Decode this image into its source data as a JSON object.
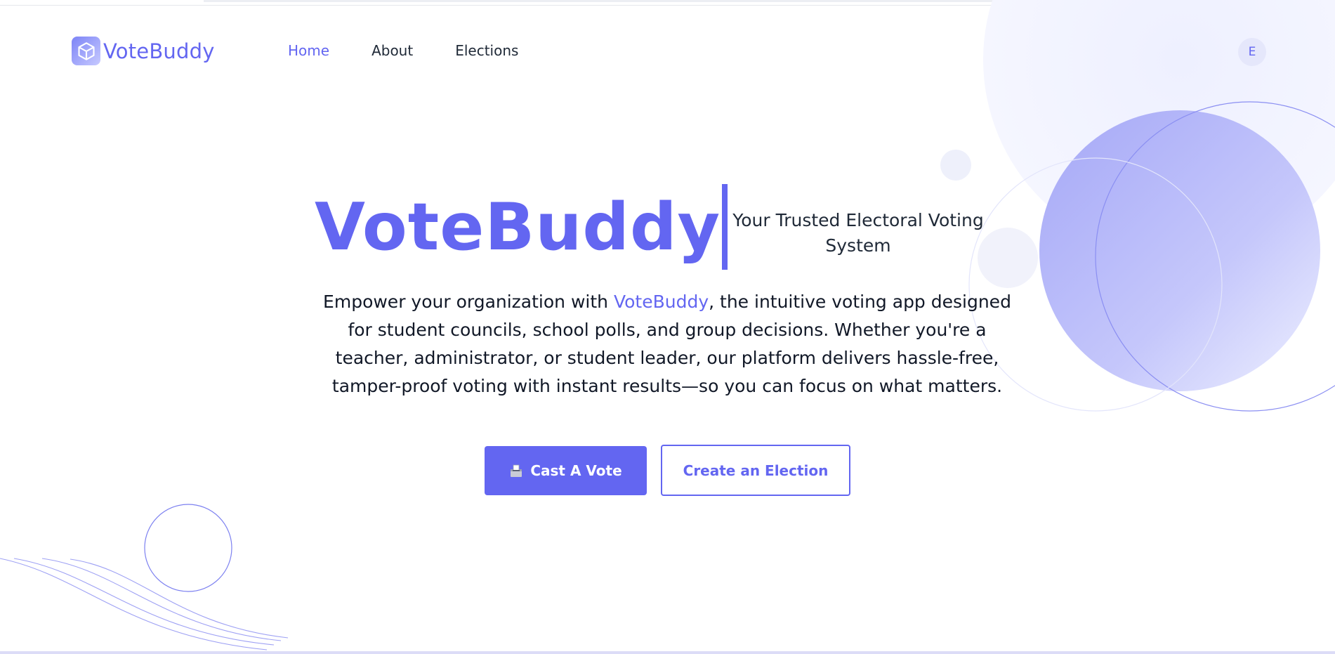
{
  "brand": {
    "name": "VoteBuddy",
    "logo_icon": "cube-icon"
  },
  "nav": {
    "items": [
      {
        "label": "Home",
        "active": true
      },
      {
        "label": "About",
        "active": false
      },
      {
        "label": "Elections",
        "active": false
      }
    ]
  },
  "user": {
    "initial": "E"
  },
  "hero": {
    "title": "VoteBuddy",
    "tagline": "Your Trusted Electoral Voting System",
    "description": {
      "before": "Empower your organization with ",
      "highlight": "VoteBuddy",
      "after": ", the intuitive voting app designed for student councils, school polls, and group decisions. Whether you're a teacher, administrator, or student leader, our platform delivers hassle-free, tamper-proof voting with instant results—so you can focus on what matters."
    },
    "primary_button": {
      "label": "Cast A Vote",
      "icon": "ballot-box-icon"
    },
    "secondary_button": {
      "label": "Create an Election"
    }
  },
  "colors": {
    "accent": "#6366f1",
    "accent_light": "#c7caff",
    "text": "#111827"
  }
}
